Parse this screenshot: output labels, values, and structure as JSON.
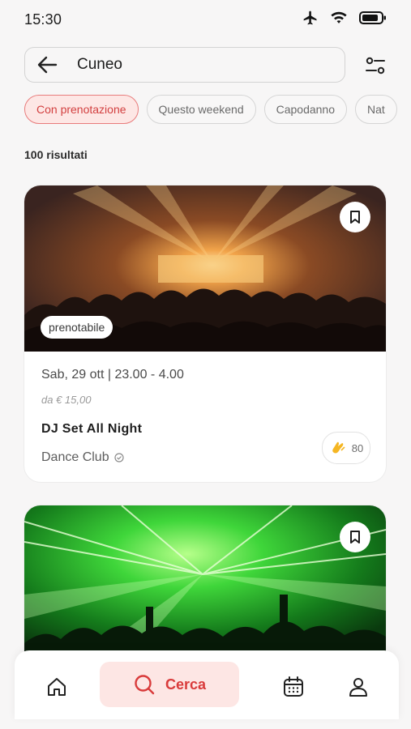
{
  "status": {
    "time": "15:30"
  },
  "search": {
    "value": "Cuneo"
  },
  "chips": [
    {
      "label": "Con prenotazione",
      "active": true
    },
    {
      "label": "Questo weekend",
      "active": false
    },
    {
      "label": "Capodanno",
      "active": false
    },
    {
      "label": "Nat",
      "active": false
    }
  ],
  "results": {
    "count_label": "100 risultati"
  },
  "events": [
    {
      "badge": "prenotabile",
      "date": "Sab, 29 ott | 23.00 - 4.00",
      "price": "da € 15,00",
      "title": "DJ Set All Night",
      "venue": "Dance Club",
      "likes": "80"
    }
  ],
  "nav": {
    "search_label": "Cerca"
  },
  "colors": {
    "accent": "#d93b3b",
    "accent_bg": "#fde6e4",
    "chip_active_border": "#e87b7b"
  },
  "icons": [
    "back-arrow-icon",
    "filter-sliders-icon",
    "bookmark-icon",
    "verified-icon",
    "clap-icon",
    "home-icon",
    "search-icon",
    "calendar-icon",
    "profile-icon",
    "airplane-icon",
    "wifi-icon",
    "battery-icon"
  ]
}
